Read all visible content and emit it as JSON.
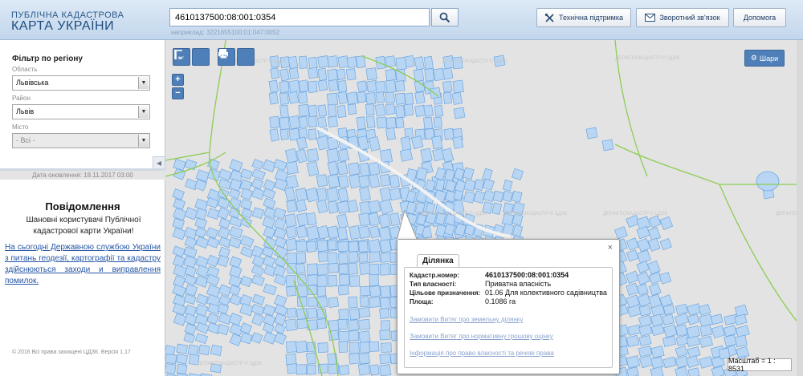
{
  "header": {
    "logo_top": "ПУБЛІЧНА КАДАСТРОВА",
    "logo_bottom": "КАРТА УКРАЇНИ",
    "search_value": "4610137500:08:001:0354",
    "search_hint": "наприклад: 3221655100:01:047:0052",
    "support_label": "Технічна підтримка",
    "feedback_label": "Зворотний зв'язок",
    "help_label": "Допомога"
  },
  "sidebar": {
    "filter_title": "Фільтр по регіону",
    "region_label": "Область",
    "region_value": "Львівська",
    "district_label": "Район",
    "district_value": "Львів",
    "city_label": "Місто",
    "city_value": "- Всі -",
    "update_date": "Дата оновлення: 18.11.2017 03:00"
  },
  "messages": {
    "title": "Повідомлення",
    "text": "Шановні користувачі Публічної кадастрової карти України!",
    "link": "На сьогодні Державною службою України з питань геодезії, картографії та кадастру здійснюються заходи и виправлення помилок.",
    "copyright": "© 2016 Всі права захищені ЦДЗК. Версія 1.17"
  },
  "map": {
    "tools": {
      "measure_length": "м",
      "measure_area": "м²"
    },
    "zoom_in": "+",
    "zoom_out": "−",
    "layers_label": "Шари",
    "scale_text": "Масштаб = 1 : 8531",
    "watermark": "ДЕРЖГЕОКАДАСТР © ЦДЗК"
  },
  "popup": {
    "tab": "Ділянка",
    "close": "×",
    "props": [
      {
        "label": "Кадастр.номер:",
        "value": "4610137500:08:001:0354"
      },
      {
        "label": "Тип власності:",
        "value": "Приватна власність"
      },
      {
        "label": "Цільове призначення:",
        "value": "01.06 Для колективного садівництва"
      },
      {
        "label": "Площа:",
        "value": "0.1086 га"
      }
    ],
    "links": [
      "Замовити Витяг про земельну ділянку",
      "Замовити Витяг про нормативну грошову оцінку",
      "Інформація про право власності та речові права"
    ]
  },
  "colors": {
    "parcel_fill": "#b8d6f4",
    "parcel_stroke": "#6ea6df",
    "boundary": "#8ccd52",
    "tool_blue": "#4f7fb8"
  }
}
